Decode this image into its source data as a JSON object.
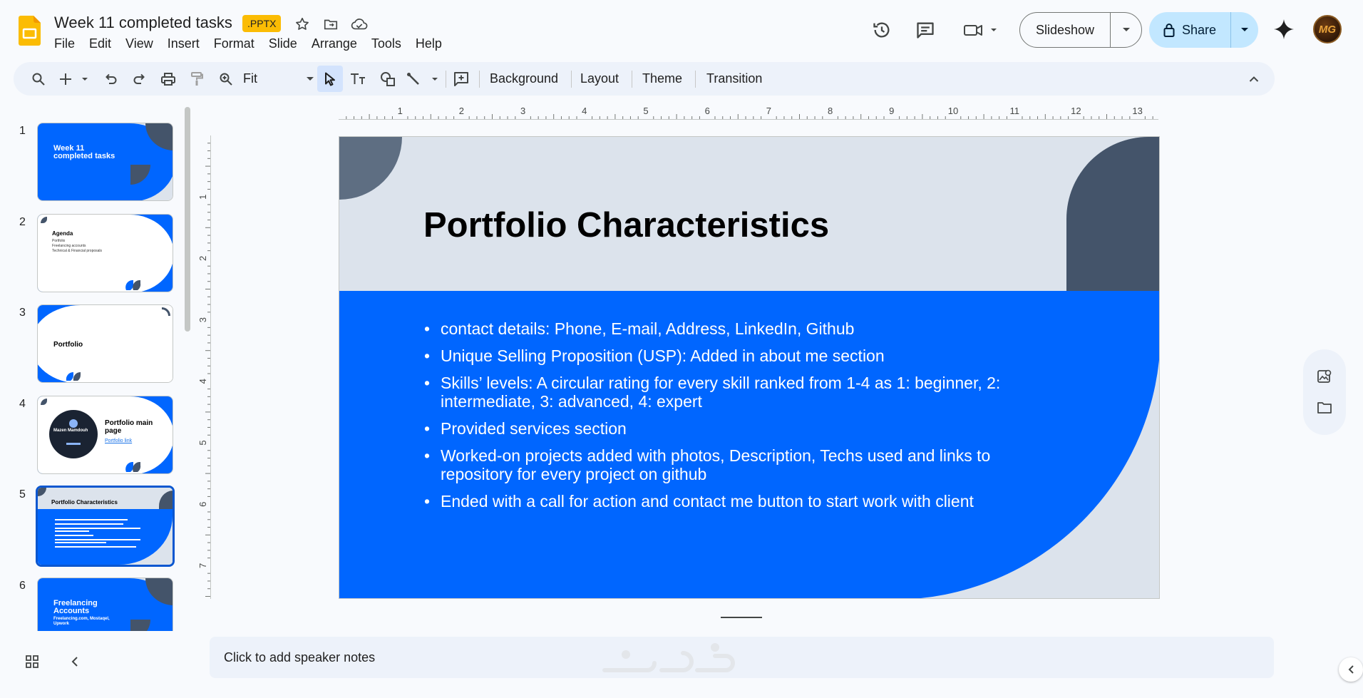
{
  "app": {
    "doc_title": "Week 11 completed tasks",
    "file_badge": ".PPTX",
    "menu": [
      "File",
      "Edit",
      "View",
      "Insert",
      "Format",
      "Slide",
      "Arrange",
      "Tools",
      "Help"
    ],
    "slideshow_label": "Slideshow",
    "share_label": "Share",
    "avatar_initials": "MG"
  },
  "toolbar": {
    "zoom_label": "Fit",
    "background_label": "Background",
    "layout_label": "Layout",
    "theme_label": "Theme",
    "transition_label": "Transition"
  },
  "ruler": {
    "top": [
      "1",
      "2",
      "3",
      "4",
      "5",
      "6",
      "7",
      "8",
      "9",
      "10",
      "11",
      "12",
      "13"
    ],
    "left": [
      "1",
      "2",
      "3",
      "4",
      "5",
      "6",
      "7"
    ]
  },
  "filmstrip": {
    "slides": [
      {
        "number": "1",
        "title": "Week 11 completed tasks"
      },
      {
        "number": "2",
        "title": "Agenda",
        "lines": [
          "Portfolio",
          "Freelancing accounts",
          "Technical & Financial proposals"
        ]
      },
      {
        "number": "3",
        "title": "Portfolio"
      },
      {
        "number": "4",
        "title": "Portfolio main page",
        "link": "Portfolio link",
        "profile_name": "Mazen Mamdouh"
      },
      {
        "number": "5",
        "title": "Portfolio Characteristics"
      },
      {
        "number": "6",
        "title": "Freelancing Accounts",
        "subtitle": "Freelancing.com, Mostaqel, Upwork"
      }
    ]
  },
  "slide": {
    "title": "Portfolio Characteristics",
    "bullets": [
      "contact details: Phone, E-mail, Address, LinkedIn, Github",
      "Unique Selling Proposition (USP): Added in about me section",
      "Skills’ levels: A circular rating for every skill ranked from 1-4 as 1: beginner, 2: intermediate, 3: advanced, 4: expert",
      "Provided services section",
      "Worked-on projects added with photos, Description, Techs used and links to repository for every project on github",
      "Ended with a call for action and contact me button to start work with client"
    ]
  },
  "notes": {
    "placeholder": "Click to add speaker notes"
  },
  "colors": {
    "accent_blue": "#0066ff",
    "slide_bg": "#dce3ec",
    "leaf_dark": "#44546a",
    "share_bg": "#c2e7ff",
    "badge_yellow": "#fbbc04"
  }
}
